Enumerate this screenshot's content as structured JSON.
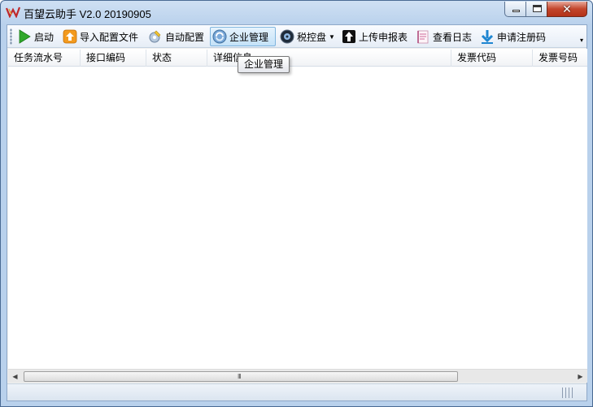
{
  "window": {
    "title": "百望云助手 V2.0  20190905",
    "controls": {
      "close_glyph": "✕"
    }
  },
  "toolbar": {
    "items": [
      {
        "label": "启动",
        "icon": "play-icon"
      },
      {
        "label": "导入配置文件",
        "icon": "import-icon"
      },
      {
        "label": "自动配置",
        "icon": "auto-config-icon"
      },
      {
        "label": "企业管理",
        "icon": "enterprise-icon"
      },
      {
        "label": "税控盘",
        "icon": "tax-disk-icon",
        "dropdown_glyph": "▼"
      },
      {
        "label": "上传申报表",
        "icon": "upload-icon"
      },
      {
        "label": "查看日志",
        "icon": "log-icon"
      },
      {
        "label": "申请注册码",
        "icon": "download-icon"
      }
    ],
    "overflow_glyph": "▾"
  },
  "grid": {
    "columns": [
      "任务流水号",
      "接口编码",
      "状态",
      "详细信息",
      "发票代码",
      "发票号码"
    ],
    "rows": []
  },
  "tooltip": {
    "text": "企业管理"
  },
  "scrollbar": {
    "left_glyph": "◀",
    "right_glyph": "▶",
    "thumb_glyph": "III"
  },
  "colors": {
    "title_gradient_top": "#cfe0f3",
    "toolbar_hover": "#c4e2f8",
    "close_button": "#c3452c",
    "play_green": "#2fa82b",
    "import_orange": "#f39a1e",
    "upload_black": "#111111",
    "download_blue": "#1f86d1"
  }
}
